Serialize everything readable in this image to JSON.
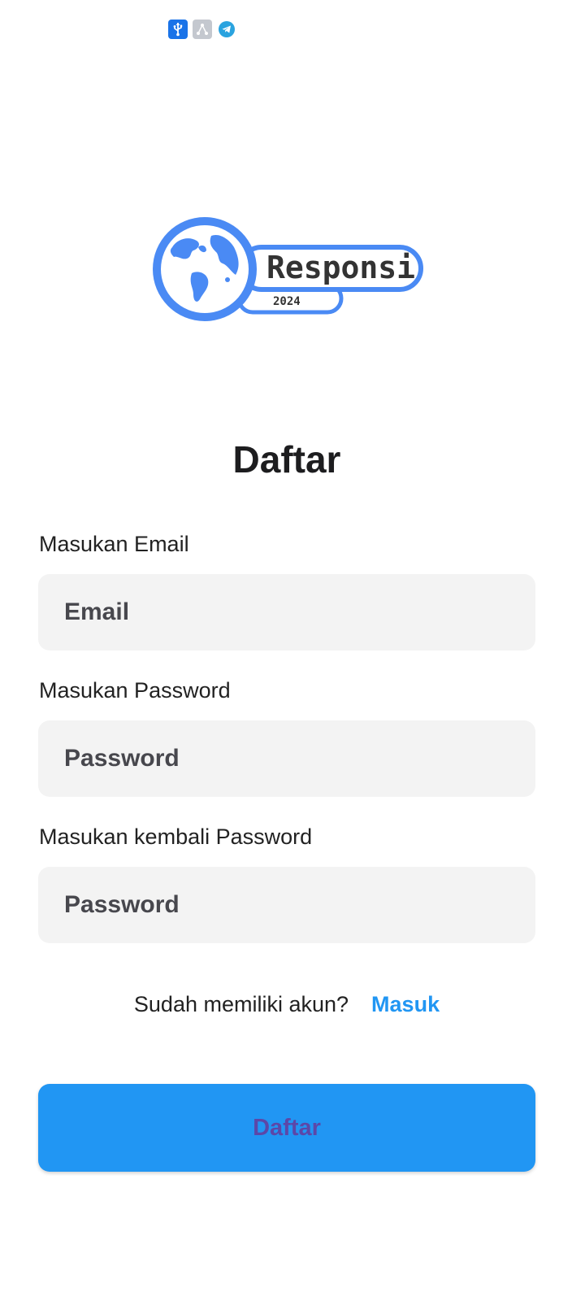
{
  "status_bar": {
    "icons": [
      "usb-icon",
      "triangle-share-icon",
      "telegram-icon"
    ]
  },
  "logo": {
    "brand_text": "Responsi",
    "year_text": "2024",
    "color": "#4a8af4"
  },
  "page": {
    "title": "Daftar"
  },
  "form": {
    "email": {
      "label": "Masukan Email",
      "placeholder": "Email",
      "value": ""
    },
    "password": {
      "label": "Masukan Password",
      "placeholder": "Password",
      "value": ""
    },
    "confirm_password": {
      "label": "Masukan kembali Password",
      "placeholder": "Password",
      "value": ""
    }
  },
  "account_prompt": {
    "text": "Sudah memiliki akun?",
    "link_label": "Masuk"
  },
  "submit": {
    "label": "Daftar"
  },
  "colors": {
    "accent": "#2196f3",
    "button_text": "#5c47a8",
    "input_bg": "#f3f3f3"
  }
}
